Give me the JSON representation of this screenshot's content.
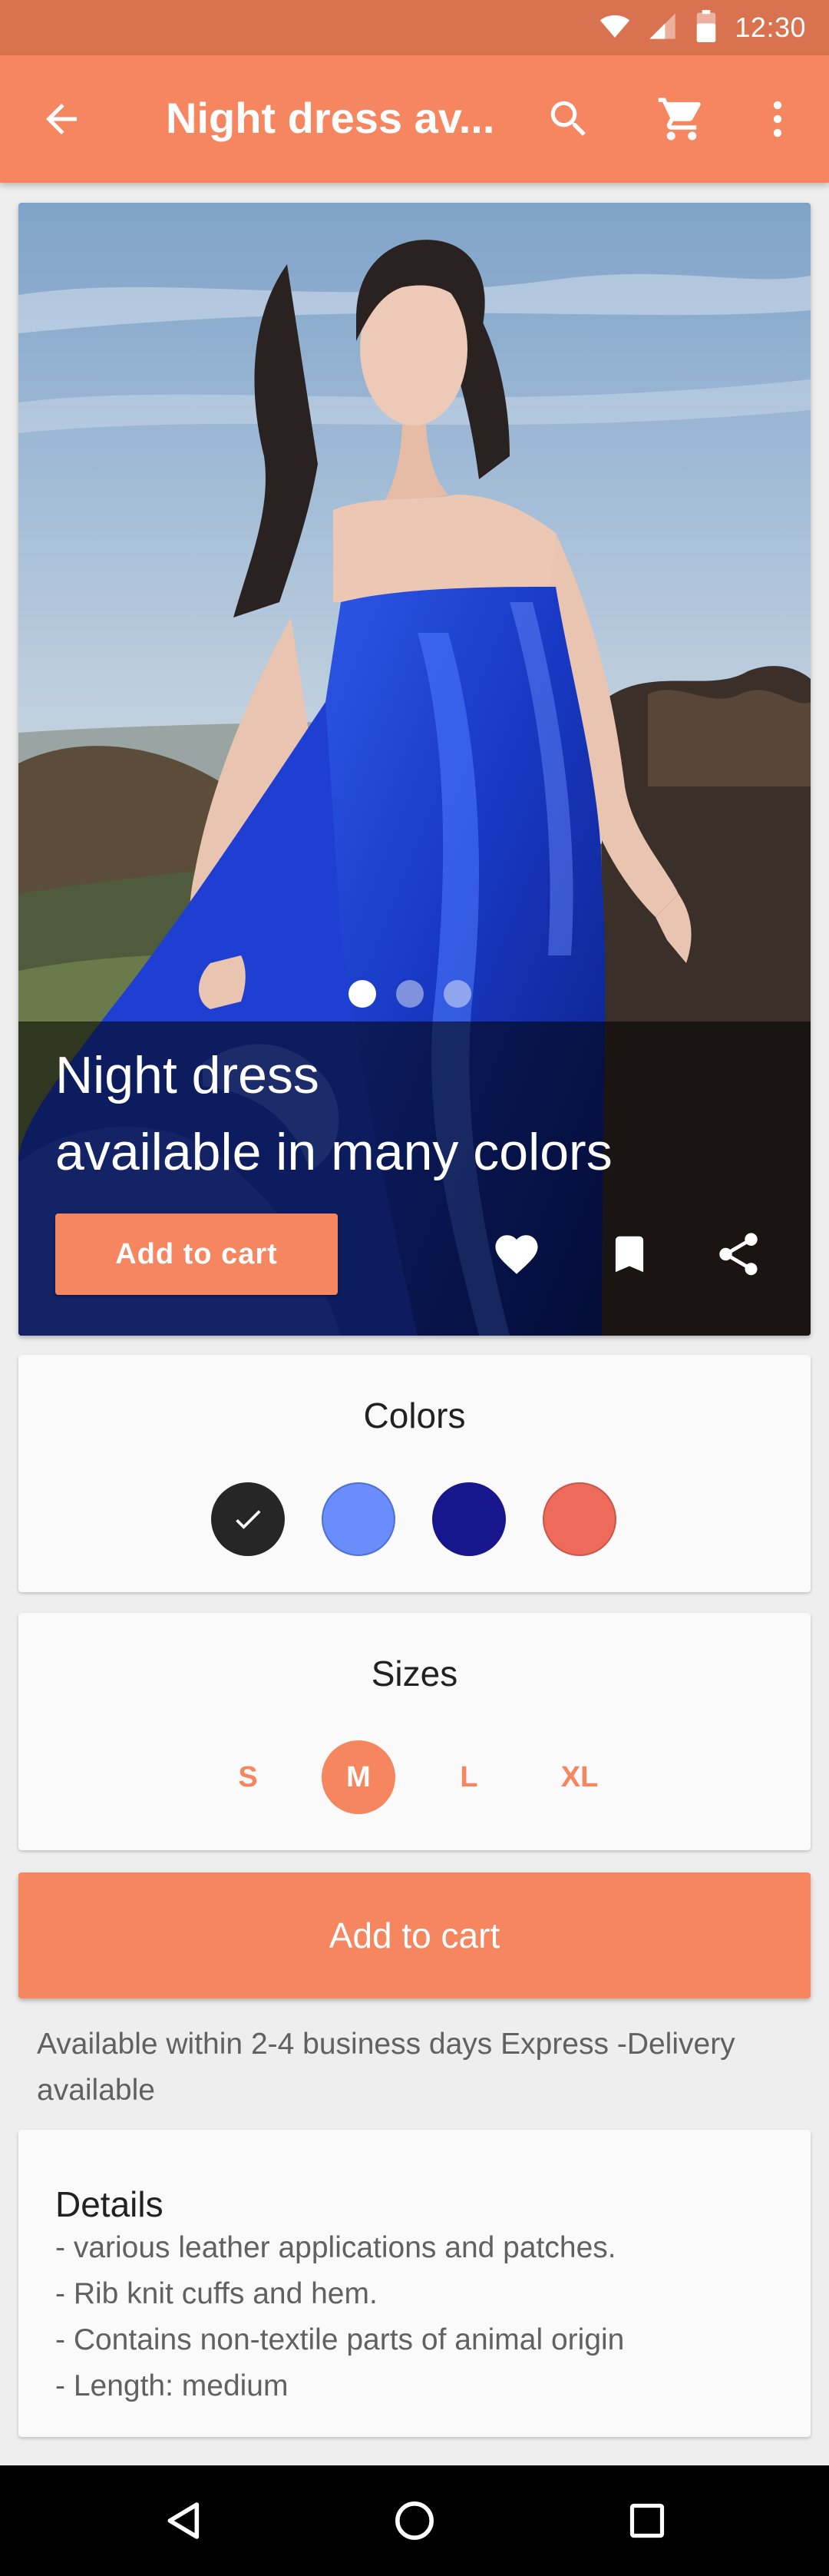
{
  "status_bar": {
    "time": "12:30",
    "icons": [
      "wifi-icon",
      "signal-icon",
      "battery-icon"
    ]
  },
  "app_bar": {
    "title": "Night dress av...",
    "icons": [
      "back-arrow-icon",
      "search-icon",
      "cart-icon",
      "more-vert-icon"
    ]
  },
  "hero": {
    "title_line1": "Night dress",
    "title_line2": "available in many colors",
    "add_to_cart": "Add to cart",
    "page_count": 3,
    "active_page": 1,
    "actions": [
      "favorite-icon",
      "bookmark-icon",
      "share-icon"
    ]
  },
  "colors": {
    "heading": "Colors",
    "swatches": [
      {
        "name": "black",
        "hex": "#262626",
        "selected": true
      },
      {
        "name": "light-blue",
        "hex": "#6a8dfb",
        "selected": false
      },
      {
        "name": "navy",
        "hex": "#17168c",
        "selected": false
      },
      {
        "name": "coral",
        "hex": "#ee6a5b",
        "selected": false
      }
    ]
  },
  "sizes": {
    "heading": "Sizes",
    "options": [
      "S",
      "M",
      "L",
      "XL"
    ],
    "selected": "M"
  },
  "add_to_cart_button": "Add to cart",
  "availability": "Available within 2-4 business days Express -Delivery available",
  "details": {
    "title": "Details",
    "lines": [
      "- various leather applications and patches.",
      "- Rib knit cuffs and hem.",
      "- Contains non-textile parts of animal origin",
      "- Length: medium"
    ]
  },
  "nav_bar": {
    "icons": [
      "back-triangle-icon",
      "home-circle-icon",
      "recents-square-icon"
    ]
  },
  "theme": {
    "accent": "#f58660",
    "status_bar": "#d9724f"
  }
}
